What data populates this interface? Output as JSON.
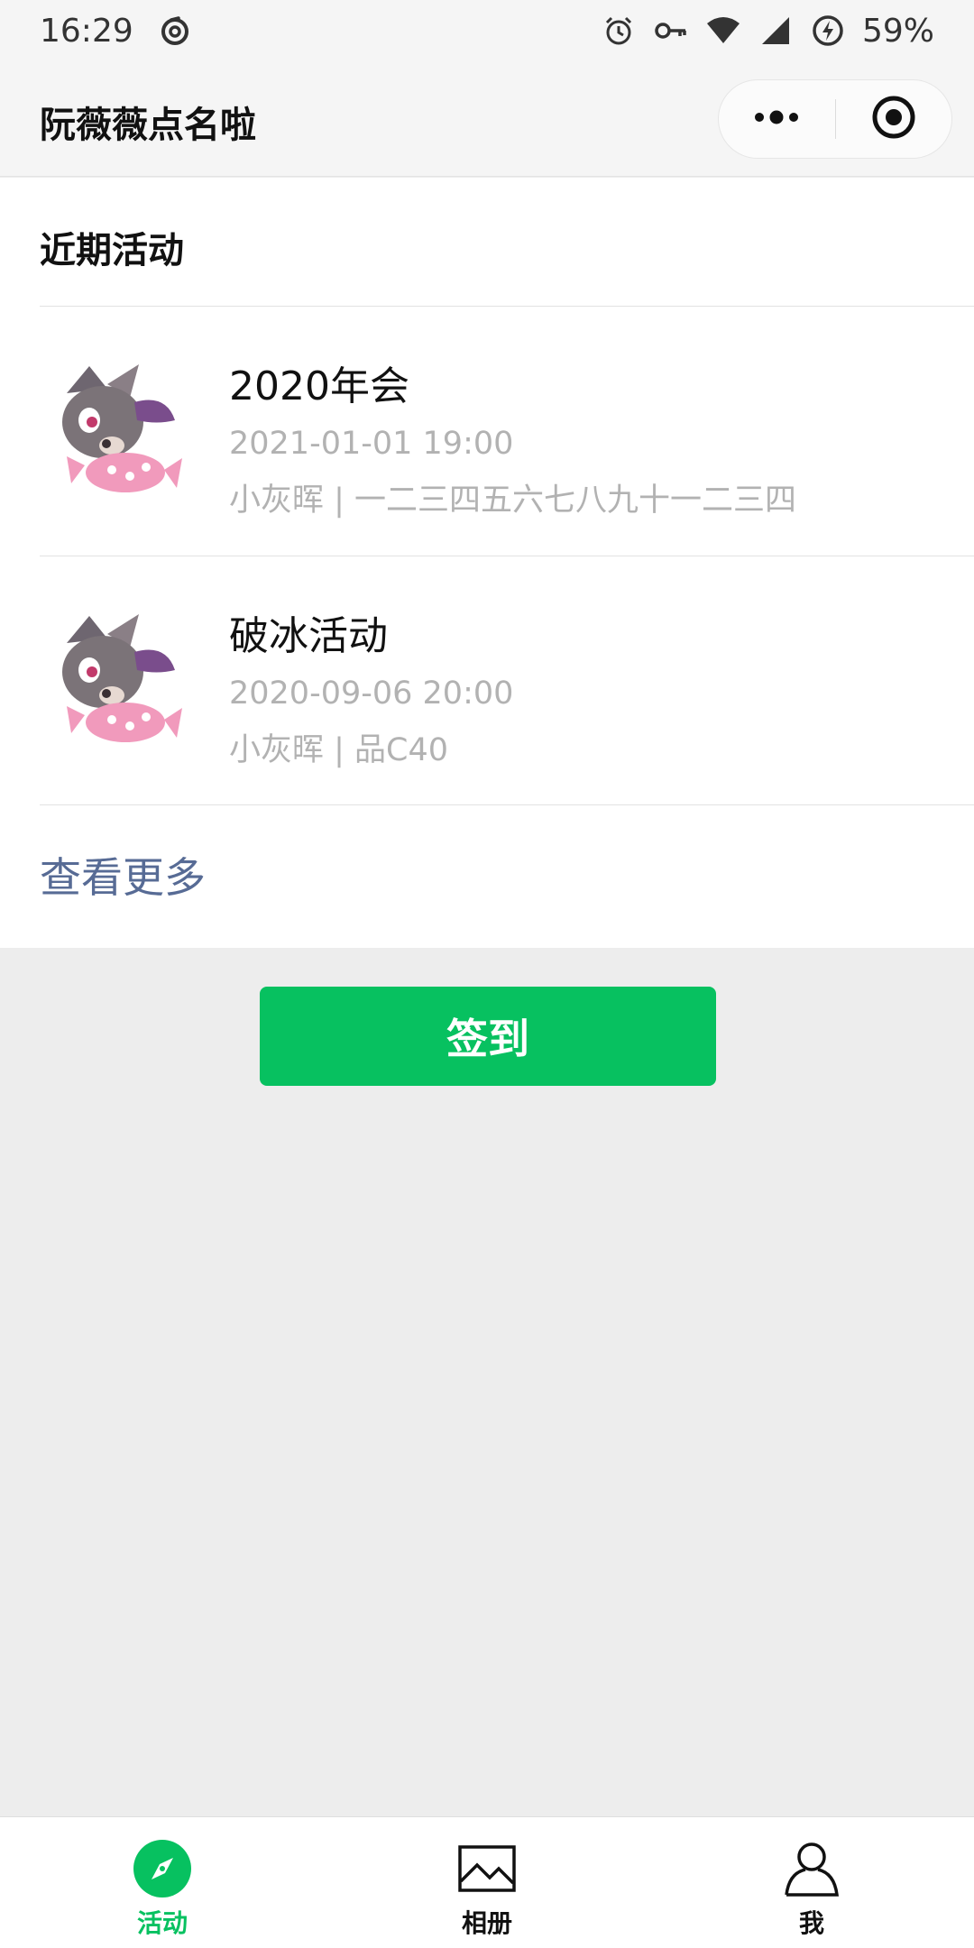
{
  "status_bar": {
    "time": "16:29",
    "battery": "59%",
    "icons": [
      "netease-music-icon",
      "alarm-icon",
      "key-icon",
      "wifi-icon",
      "signal-icon",
      "battery-icon"
    ]
  },
  "nav": {
    "title": "阮薇薇点名啦",
    "more_icon": "more-dots-icon",
    "close_icon": "target-circle-icon"
  },
  "section": {
    "title": "近期活动"
  },
  "activities": [
    {
      "title": "2020年会",
      "time": "2021-01-01 19:00",
      "meta": "小灰晖 | 一二三四五六七八九十一二三四",
      "thumb_icon": "cartoon-wolf-avatar-icon"
    },
    {
      "title": "破冰活动",
      "time": "2020-09-06 20:00",
      "meta": "小灰晖 | 品C40",
      "thumb_icon": "cartoon-wolf-avatar-icon"
    }
  ],
  "more_label": "查看更多",
  "sign_button": "签到",
  "tabs": [
    {
      "label": "活动",
      "icon": "compass-icon",
      "active": true
    },
    {
      "label": "相册",
      "icon": "picture-icon",
      "active": false
    },
    {
      "label": "我",
      "icon": "person-icon",
      "active": false
    }
  ],
  "colors": {
    "accent": "#07c160",
    "link": "#576b95",
    "secondary_text": "#b2b2b2",
    "page_bg": "#ededed"
  }
}
